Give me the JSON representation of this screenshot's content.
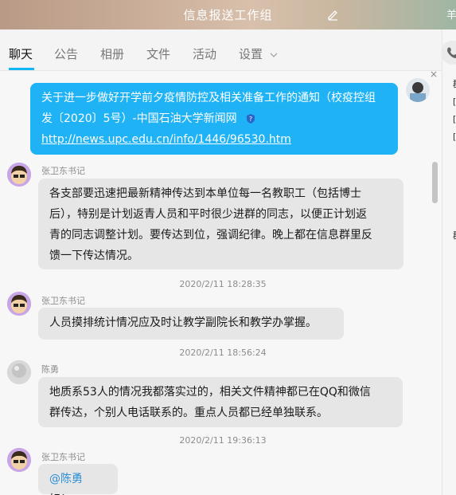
{
  "window": {
    "title": "信息报送工作组",
    "corner_text": "羊"
  },
  "tabs": [
    {
      "label": "聊天"
    },
    {
      "label": "公告"
    },
    {
      "label": "相册"
    },
    {
      "label": "文件"
    },
    {
      "label": "活动"
    },
    {
      "label": "设置"
    }
  ],
  "messages": {
    "top": {
      "line1": "关于进一步做好开学前夕疫情防控及相关准备工作的通知（校疫控组",
      "line2": "发〔2020〕5号）-中国石油大学新闻网",
      "link": "http://news.upc.edu.cn/info/1446/96530.htm"
    },
    "m1": {
      "sender": "张卫东书记",
      "lines": [
        "各支部要迅速把最新精神传达到本单位每一名教职工（包括博士",
        "后），特别是计划返青人员和平时很少进群的同志，以便正计划返",
        "青的同志调整计划。要传达到位，强调纪律。晚上都在信息群里反",
        "馈一下传达情况。"
      ]
    },
    "t1": "2020/2/11 18:28:35",
    "m2": {
      "sender": "张卫东书记",
      "text": "人员摸排统计情况应及时让教学副院长和教学办掌握。"
    },
    "t2": "2020/2/11 18:56:24",
    "m3": {
      "sender": "陈勇",
      "lines": [
        "地质系53人的情况我都落实过的，相关文件精神都已在QQ和微信",
        "群传达，个别人电话联系的。重点人员都已经单独联系。"
      ]
    },
    "t3": "2020/2/11 19:36:13",
    "m4": {
      "sender": "张卫东书记",
      "mention": "@陈勇",
      "text": " 好！"
    }
  },
  "side_marks": [
    "群",
    "[",
    "[",
    "[",
    "群"
  ],
  "colors": {
    "accent": "#12b7f5",
    "my_bubble": "#1fb3f5",
    "bubble": "#e6e6e6"
  }
}
